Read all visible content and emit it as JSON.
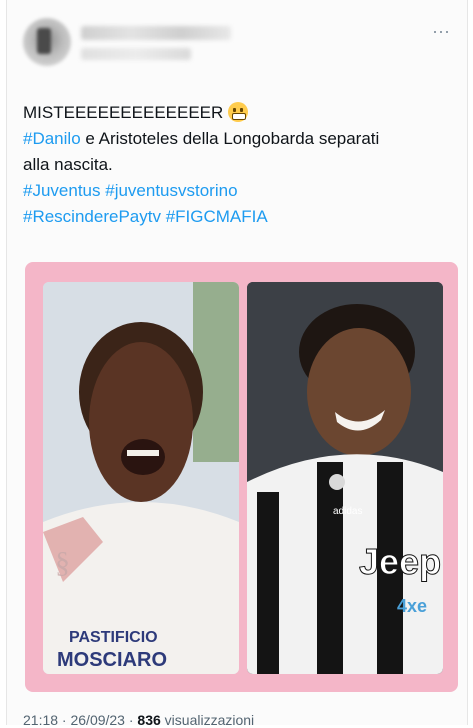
{
  "tweet": {
    "more_icon": "⋯",
    "line1": "MISTEEEEEEEEEEEEER",
    "line1_emoji": "grimacing-face",
    "hashtag_danilo": "#Danilo",
    "line2_rest": " e Aristoteles della Longobarda separati",
    "line3": "alla nascita.",
    "hashtag_juventus": "#Juventus",
    "hashtag_juventusvstorino": "#juventusvstorino",
    "hashtag_rescindere": "#RescinderePaytv",
    "hashtag_figcmafia": "#FIGCMAFIA"
  },
  "media": {
    "background_color": "#f4b6c8",
    "left_photo_text": "PASTIFICIO MOSCIARO",
    "right_photo_text": "Jeep 4xe"
  },
  "footer": {
    "time": "21:18 · 26/09/23 ·",
    "views_count": "836",
    "views_label": " visualizzazioni"
  }
}
